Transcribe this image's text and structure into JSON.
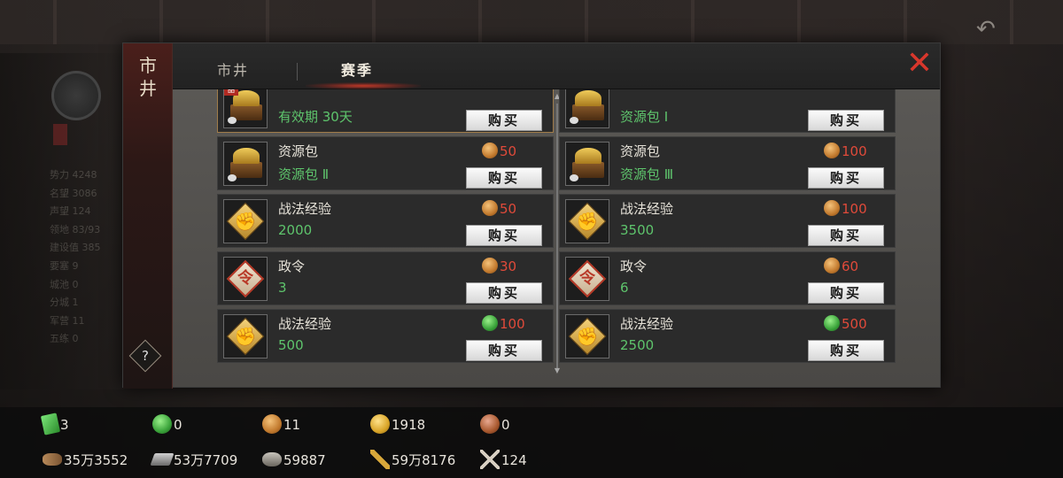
{
  "window": {
    "side_title": "市井",
    "tabs": [
      {
        "label": "市井",
        "active": false
      },
      {
        "label": "赛季",
        "active": true
      }
    ],
    "close_label": "✕",
    "help_label": "?"
  },
  "background": {
    "stats_text": [
      "势力 4248",
      "名望 3086",
      "声望 124",
      "领地 83/93",
      "建设值 385",
      "要塞 9",
      "城池 0",
      "分城 1",
      "军营 11",
      "五练 0"
    ]
  },
  "items": [
    {
      "name": "",
      "sub": "有效期 30天",
      "price": "",
      "currency": "copper",
      "icon": "chest-bag-icon",
      "buy_label": "购买",
      "badge": "品",
      "selected": true,
      "partial": true
    },
    {
      "name": "",
      "sub": "资源包 Ⅰ",
      "price": "",
      "currency": "copper",
      "icon": "chest-bag-icon",
      "buy_label": "购买",
      "selected": false,
      "partial": true
    },
    {
      "name": "资源包",
      "sub": "资源包 Ⅱ",
      "price": "50",
      "currency": "copper",
      "icon": "chest-bag-icon",
      "buy_label": "购买"
    },
    {
      "name": "资源包",
      "sub": "资源包 Ⅲ",
      "price": "100",
      "currency": "copper",
      "icon": "chest-bag-icon",
      "buy_label": "购买"
    },
    {
      "name": "战法经验",
      "sub": "2000",
      "price": "50",
      "currency": "copper",
      "icon": "fist-tactic-icon",
      "buy_label": "购买"
    },
    {
      "name": "战法经验",
      "sub": "3500",
      "price": "100",
      "currency": "copper",
      "icon": "fist-tactic-icon",
      "buy_label": "购买"
    },
    {
      "name": "政令",
      "sub": "3",
      "price": "30",
      "currency": "copper",
      "icon": "decree-order-icon",
      "buy_label": "购买"
    },
    {
      "name": "政令",
      "sub": "6",
      "price": "60",
      "currency": "copper",
      "icon": "decree-order-icon",
      "buy_label": "购买"
    },
    {
      "name": "战法经验",
      "sub": "500",
      "price": "100",
      "currency": "jade",
      "icon": "fist-tactic-icon",
      "buy_label": "购买"
    },
    {
      "name": "战法经验",
      "sub": "2500",
      "price": "500",
      "currency": "jade",
      "icon": "fist-tactic-icon",
      "buy_label": "购买"
    }
  ],
  "resources": {
    "row1": [
      {
        "icon": "jade-card-icon",
        "value": "3"
      },
      {
        "icon": "jade-coin-icon",
        "value": "0"
      },
      {
        "icon": "copper-coin-icon",
        "value": "11"
      },
      {
        "icon": "gold-coin-icon",
        "value": "1918"
      },
      {
        "icon": "bronze-coin-icon",
        "value": "0"
      }
    ],
    "row2": [
      {
        "icon": "wood-icon",
        "value": "35万3552"
      },
      {
        "icon": "iron-icon",
        "value": "53万7709"
      },
      {
        "icon": "stone-icon",
        "value": "59887"
      },
      {
        "icon": "grain-icon",
        "value": "59万8176"
      },
      {
        "icon": "crossed-swords-icon",
        "value": "124"
      }
    ]
  },
  "colors": {
    "accent_red": "#d8372c",
    "price_red": "#e04a3a",
    "sub_green": "#5ec46c"
  }
}
